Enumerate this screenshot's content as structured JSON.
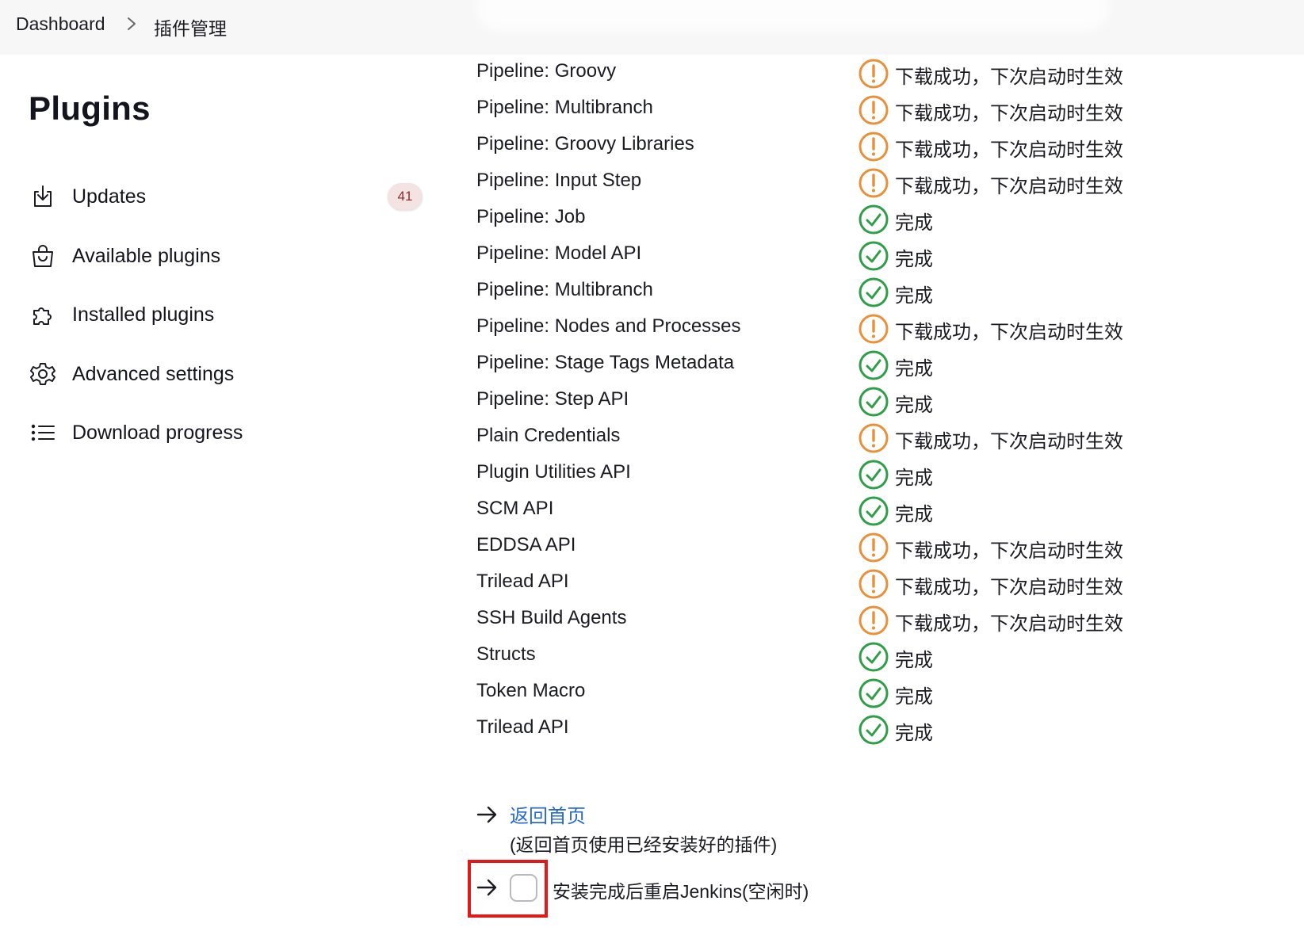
{
  "breadcrumb": {
    "items": [
      "Dashboard",
      "插件管理"
    ]
  },
  "page": {
    "title": "Plugins"
  },
  "sidebar": {
    "items": [
      {
        "label": "Updates",
        "icon": "download-icon",
        "badge": "41"
      },
      {
        "label": "Available plugins",
        "icon": "shopping-bag-icon"
      },
      {
        "label": "Installed plugins",
        "icon": "puzzle-icon"
      },
      {
        "label": "Advanced settings",
        "icon": "gear-icon"
      },
      {
        "label": "Download progress",
        "icon": "list-icon"
      }
    ]
  },
  "status_labels": {
    "pending": "下载成功，下次启动时生效",
    "done": "完成"
  },
  "colors": {
    "warning": "#e8903a",
    "success": "#2e9e47",
    "link": "#2668d6",
    "badge_bg": "#f3e3e3",
    "highlight": "#e21919"
  },
  "plugins": [
    {
      "name": "Pipeline: Groovy",
      "status": "pending",
      "status_text": "下载成功，下次启动时生效"
    },
    {
      "name": "Pipeline: Multibranch",
      "status": "pending",
      "status_text": "下载成功，下次启动时生效"
    },
    {
      "name": "Pipeline: Groovy Libraries",
      "status": "pending",
      "status_text": "下载成功，下次启动时生效"
    },
    {
      "name": "Pipeline: Input Step",
      "status": "pending",
      "status_text": "下载成功，下次启动时生效"
    },
    {
      "name": "Pipeline: Job",
      "status": "done",
      "status_text": "完成"
    },
    {
      "name": "Pipeline: Model API",
      "status": "done",
      "status_text": "完成"
    },
    {
      "name": "Pipeline: Multibranch",
      "status": "done",
      "status_text": "完成"
    },
    {
      "name": "Pipeline: Nodes and Processes",
      "status": "pending",
      "status_text": "下载成功，下次启动时生效"
    },
    {
      "name": "Pipeline: Stage Tags Metadata",
      "status": "done",
      "status_text": "完成"
    },
    {
      "name": "Pipeline: Step API",
      "status": "done",
      "status_text": "完成"
    },
    {
      "name": "Plain Credentials",
      "status": "pending",
      "status_text": "下载成功，下次启动时生效"
    },
    {
      "name": "Plugin Utilities API",
      "status": "done",
      "status_text": "完成"
    },
    {
      "name": "SCM API",
      "status": "done",
      "status_text": "完成"
    },
    {
      "name": "EDDSA API",
      "status": "pending",
      "status_text": "下载成功，下次启动时生效"
    },
    {
      "name": "Trilead API",
      "status": "pending",
      "status_text": "下载成功，下次启动时生效"
    },
    {
      "name": "SSH Build Agents",
      "status": "pending",
      "status_text": "下载成功，下次启动时生效"
    },
    {
      "name": "Structs",
      "status": "done",
      "status_text": "完成"
    },
    {
      "name": "Token Macro",
      "status": "done",
      "status_text": "完成"
    },
    {
      "name": "Trilead API",
      "status": "done",
      "status_text": "完成"
    }
  ],
  "footer": {
    "back_link": "返回首页",
    "back_desc": "(返回首页使用已经安装好的插件)",
    "restart_label": "安装完成后重启Jenkins(空闲时)",
    "restart_checked": false
  }
}
